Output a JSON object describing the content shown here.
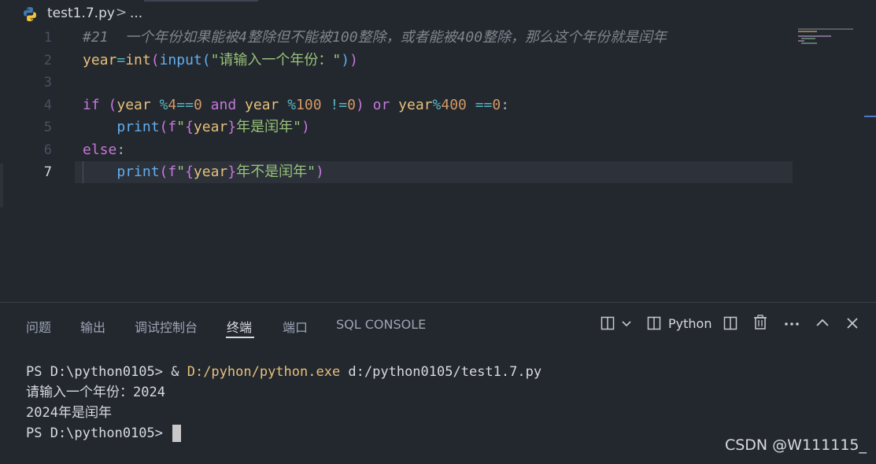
{
  "breadcrumb": {
    "file": "test1.7.py",
    "separator": ">",
    "more": "..."
  },
  "editor": {
    "line_numbers": [
      "1",
      "2",
      "3",
      "4",
      "5",
      "6",
      "7"
    ],
    "line1": {
      "comment": "#21  一个年份如果能被4整除但不能被100整除，或者能被400整除，那么这个年份就是闰年"
    },
    "line2": {
      "var": "year",
      "eq": "=",
      "int": "int",
      "p1": "(",
      "input": "input",
      "p2": "(",
      "str": "\"请输入一个年份：\"",
      "p3": ")",
      "p4": ")"
    },
    "line4": {
      "if": "if",
      "sp1": " ",
      "p1": "(",
      "year1": "year",
      "sp2": " ",
      "mod1": "%",
      "n4": "4",
      "eq1": "==",
      "z1": "0",
      "sp3": " ",
      "and": "and",
      "sp4": " ",
      "year2": "year",
      "sp5": " ",
      "mod2": "%",
      "n100": "100",
      "sp6": " ",
      "ne": "!=",
      "z2": "0",
      "p2": ")",
      "sp7": " ",
      "or": "or",
      "sp8": " ",
      "year3": "year",
      "mod3": "%",
      "n400": "400",
      "sp9": " ",
      "eq2": "==",
      "z3": "0",
      "colon": ":"
    },
    "line5": {
      "indent": "    ",
      "print": "print",
      "p1": "(",
      "f": "f",
      "q1": "\"",
      "b1": "{",
      "year": "year",
      "b2": "}",
      "text": "年是闰年",
      "q2": "\"",
      "p2": ")"
    },
    "line6": {
      "else": "else",
      "colon": ":"
    },
    "line7": {
      "indent": "    ",
      "print": "print",
      "p1": "(",
      "f": "f",
      "q1": "\"",
      "b1": "{",
      "year": "year",
      "b2": "}",
      "text": "年不是闰年",
      "q2": "\"",
      "p2": ")"
    }
  },
  "panel": {
    "tabs": [
      "问题",
      "输出",
      "调试控制台",
      "终端",
      "端口",
      "SQL CONSOLE"
    ],
    "active_tab": "终端",
    "python_label": "Python"
  },
  "terminal": {
    "line1_prompt": "PS D:\\python0105> ",
    "line1_amp": "& ",
    "line1_exe": "D:/pyhon/python.exe",
    "line1_arg": " d:/python0105/test1.7.py",
    "line2": "请输入一个年份：2024",
    "line3": "2024年是闰年",
    "line4_prompt": "PS D:\\python0105> "
  },
  "watermark": "CSDN @W111115_",
  "colors": {
    "background": "#23272e",
    "keyword": "#c678dd",
    "variable": "#e5c07b",
    "function": "#61afef",
    "string": "#98c379",
    "number": "#d19a66",
    "operator": "#56b6c2"
  }
}
